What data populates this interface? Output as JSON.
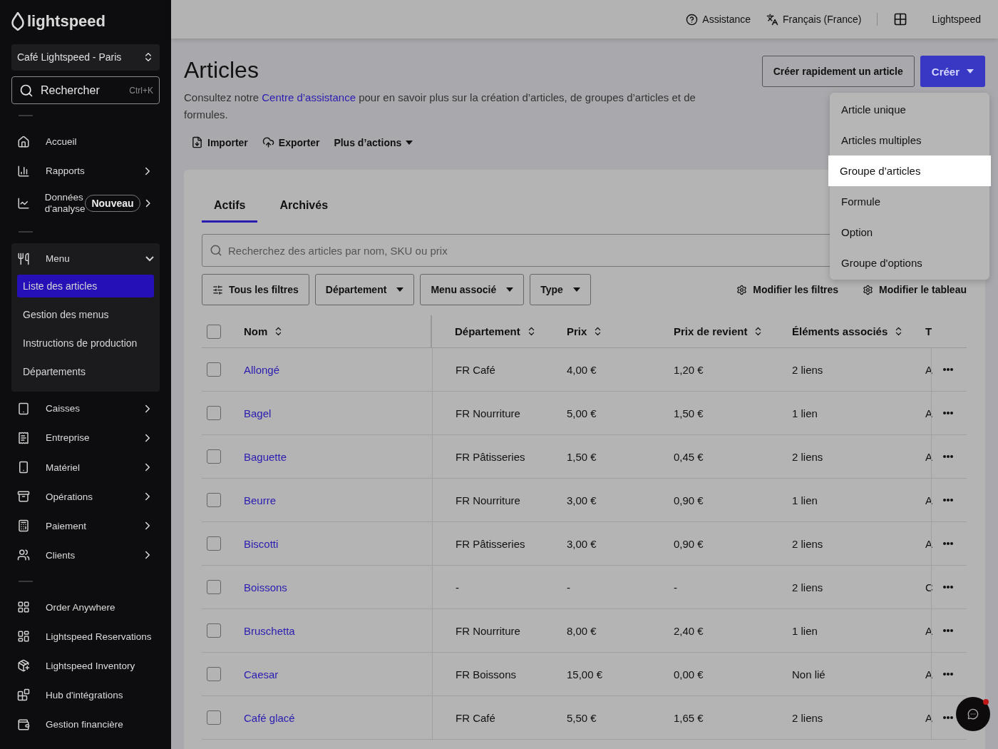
{
  "sidebar": {
    "logo": "lightspeed",
    "location": "Café Lightspeed - Paris",
    "search": {
      "placeholder": "Rechercher",
      "shortcut": "Ctrl+K"
    },
    "sections": [
      {
        "items": [
          {
            "kind": "link",
            "label": "Accueil",
            "has_submenu": false
          },
          {
            "kind": "link",
            "label": "Rapports",
            "has_submenu": true
          },
          {
            "kind": "link",
            "label": "Données d'analyse",
            "badge": "Nouveau",
            "has_submenu": true
          }
        ]
      },
      {
        "items": [
          {
            "kind": "group",
            "label": "Menu",
            "expanded": true,
            "children": [
              {
                "label": "Liste des articles",
                "selected": true
              },
              {
                "label": "Gestion des menus",
                "selected": false
              },
              {
                "label": "Instructions de production",
                "selected": false
              },
              {
                "label": "Départements",
                "selected": false
              }
            ]
          },
          {
            "kind": "link",
            "label": "Caisses",
            "has_submenu": true
          },
          {
            "kind": "link",
            "label": "Entreprise",
            "has_submenu": true
          },
          {
            "kind": "link",
            "label": "Matériel",
            "has_submenu": true
          },
          {
            "kind": "link",
            "label": "Opérations",
            "has_submenu": true
          },
          {
            "kind": "link",
            "label": "Paiement",
            "has_submenu": true
          },
          {
            "kind": "link",
            "label": "Clients",
            "has_submenu": true
          }
        ]
      },
      {
        "items": [
          {
            "kind": "link",
            "label": "Order Anywhere",
            "has_submenu": false
          },
          {
            "kind": "link",
            "label": "Lightspeed Reservations",
            "has_submenu": false
          },
          {
            "kind": "link",
            "label": "Lightspeed Inventory",
            "has_submenu": false
          },
          {
            "kind": "link",
            "label": "Hub d'intégrations",
            "has_submenu": false
          },
          {
            "kind": "link",
            "label": "Gestion financière",
            "has_submenu": false
          }
        ]
      }
    ]
  },
  "topbar": {
    "help": "Assistance",
    "language": "Français (France)",
    "account": "Lightspeed"
  },
  "header": {
    "title": "Articles",
    "description": {
      "before": "Consultez notre ",
      "link": "Centre d’assistance",
      "after": " pour en savoir plus sur la création d’articles, de groupes d’articles et de formules."
    },
    "actions": [
      "Importer",
      "Exporter",
      "Plus d’actions"
    ],
    "quick_create": "Créer rapidement un article",
    "create": "Créer"
  },
  "create_menu": [
    {
      "label": "Article unique",
      "selected": false
    },
    {
      "label": "Articles multiples",
      "selected": false
    },
    {
      "label": "Groupe d’articles",
      "selected": true
    },
    {
      "label": "Formule",
      "selected": false
    },
    {
      "label": "Option",
      "selected": false
    },
    {
      "label": "Groupe d'options",
      "selected": false
    }
  ],
  "tabs": [
    {
      "label": "Actifs",
      "selected": true
    },
    {
      "label": "Archivés",
      "selected": false
    }
  ],
  "search": {
    "placeholder": "Recherchez des articles par nom, SKU ou prix"
  },
  "filters": [
    {
      "label": "Tous les filtres",
      "kind": "all"
    },
    {
      "label": "Département",
      "kind": "dropdown"
    },
    {
      "label": "Menu associé",
      "kind": "dropdown"
    },
    {
      "label": "Type",
      "kind": "dropdown"
    }
  ],
  "filter_actions": [
    "Modifier les filtres",
    "Modifier le tableau"
  ],
  "table": {
    "select_all": false,
    "columns": [
      "Nom",
      "Département",
      "Prix",
      "Prix de revient",
      "Éléments associés",
      "T"
    ],
    "rows": [
      {
        "checked": false,
        "cells": [
          "Allongé",
          "FR Café",
          "4,00 €",
          "1,20 €",
          "2 liens",
          "A"
        ]
      },
      {
        "checked": false,
        "cells": [
          "Bagel",
          "FR Nourriture",
          "5,00 €",
          "1,50 €",
          "1 lien",
          "A"
        ]
      },
      {
        "checked": false,
        "cells": [
          "Baguette",
          "FR Pâtisseries",
          "1,50 €",
          "0,45 €",
          "2 liens",
          "A"
        ]
      },
      {
        "checked": false,
        "cells": [
          "Beurre",
          "FR Nourriture",
          "3,00 €",
          "0,90 €",
          "1 lien",
          "A"
        ]
      },
      {
        "checked": false,
        "cells": [
          "Biscotti",
          "FR Pâtisseries",
          "3,00 €",
          "0,90 €",
          "2 liens",
          "A"
        ]
      },
      {
        "checked": false,
        "cells": [
          "Boissons",
          "-",
          "-",
          "-",
          "2 liens",
          "C"
        ]
      },
      {
        "checked": false,
        "cells": [
          "Bruschetta",
          "FR Nourriture",
          "8,00 €",
          "2,40 €",
          "1 lien",
          "A"
        ]
      },
      {
        "checked": false,
        "cells": [
          "Caesar",
          "FR Boissons",
          "15,00 €",
          "0,00 €",
          "Non lié",
          "A"
        ]
      },
      {
        "checked": false,
        "cells": [
          "Café glacé",
          "FR Café",
          "5,50 €",
          "1,65 €",
          "2 liens",
          "A"
        ]
      }
    ]
  },
  "chat": {
    "unread": true
  }
}
